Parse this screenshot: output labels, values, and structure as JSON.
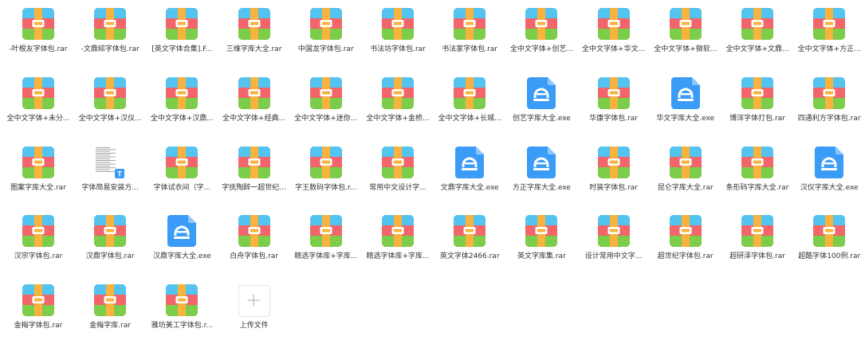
{
  "files": [
    {
      "name": "-叶根友字体包.rar",
      "icon": "archive-icon"
    },
    {
      "name": "-文鼎綜字体包.rar",
      "icon": "archive-icon"
    },
    {
      "name": "[英文字体合集].F...",
      "icon": "archive-icon"
    },
    {
      "name": "三维字库大全.rar",
      "icon": "archive-icon"
    },
    {
      "name": "中国龙字体包.rar",
      "icon": "archive-icon"
    },
    {
      "name": "书法坊字体包.rar",
      "icon": "archive-icon"
    },
    {
      "name": "书法家字体包.rar",
      "icon": "archive-icon"
    },
    {
      "name": "全中文字体+创艺...",
      "icon": "archive-icon"
    },
    {
      "name": "全中文字体+华文...",
      "icon": "archive-icon"
    },
    {
      "name": "全中文字体+微软...",
      "icon": "archive-icon"
    },
    {
      "name": "全中文字体+文鼎...",
      "icon": "archive-icon"
    },
    {
      "name": "全中文字体+方正...",
      "icon": "archive-icon"
    },
    {
      "name": "全中文字体+未分...",
      "icon": "archive-icon"
    },
    {
      "name": "全中文字体+汉仪...",
      "icon": "archive-icon"
    },
    {
      "name": "全中文字体+汉鼎...",
      "icon": "archive-icon"
    },
    {
      "name": "全中文字体+经典...",
      "icon": "archive-icon"
    },
    {
      "name": "全中文字体+迷你...",
      "icon": "archive-icon"
    },
    {
      "name": "全中文字体+金桥...",
      "icon": "archive-icon"
    },
    {
      "name": "全中文字体+长城...",
      "icon": "archive-icon"
    },
    {
      "name": "创艺字库大全.exe",
      "icon": "installer-icon"
    },
    {
      "name": "华康字体包.rar",
      "icon": "archive-icon"
    },
    {
      "name": "华文字库大全.exe",
      "icon": "installer-icon"
    },
    {
      "name": "博洋字体打包.rar",
      "icon": "archive-icon"
    },
    {
      "name": "四通利方字体包.rar",
      "icon": "archive-icon"
    },
    {
      "name": "图案字库大全.rar",
      "icon": "archive-icon"
    },
    {
      "name": "字体简易安装方...",
      "icon": "document-icon"
    },
    {
      "name": "字体试衣间（字...",
      "icon": "archive-icon"
    },
    {
      "name": "字抚陶醉一超世纪...",
      "icon": "archive-icon"
    },
    {
      "name": "字王数码字体包.r...",
      "icon": "archive-icon"
    },
    {
      "name": "常用中文设计字...",
      "icon": "archive-icon"
    },
    {
      "name": "文鼎字库大全.exe",
      "icon": "installer-icon"
    },
    {
      "name": "方正字库大全.exe",
      "icon": "installer-icon"
    },
    {
      "name": "时装字体包.rar",
      "icon": "archive-icon"
    },
    {
      "name": "昆仑字库大全.rar",
      "icon": "archive-icon"
    },
    {
      "name": "条形码字库大全.rar",
      "icon": "archive-icon"
    },
    {
      "name": "汉仪字库大全.exe",
      "icon": "installer-icon"
    },
    {
      "name": "汉宗字体包.rar",
      "icon": "archive-icon"
    },
    {
      "name": "汉鼎字体包.rar",
      "icon": "archive-icon"
    },
    {
      "name": "汉鼎字库大全.exe",
      "icon": "installer-icon"
    },
    {
      "name": "白舟字体包.rar",
      "icon": "archive-icon"
    },
    {
      "name": "精选字体库+字库...",
      "icon": "archive-icon"
    },
    {
      "name": "精选字体库+字库...",
      "icon": "archive-icon"
    },
    {
      "name": "英文字体2466.rar",
      "icon": "archive-icon"
    },
    {
      "name": "英文字库集.rar",
      "icon": "archive-icon"
    },
    {
      "name": "设计常用中文字...",
      "icon": "archive-icon"
    },
    {
      "name": "超世纪字体包.rar",
      "icon": "archive-icon"
    },
    {
      "name": "超研泽字体包.rar",
      "icon": "archive-icon"
    },
    {
      "name": "超酷字体100例.rar",
      "icon": "archive-icon"
    },
    {
      "name": "金梅字体包.rar",
      "icon": "archive-icon"
    },
    {
      "name": "金梅字库.rar",
      "icon": "archive-icon"
    },
    {
      "name": "雅坊美工字体包.r...",
      "icon": "archive-icon"
    }
  ],
  "upload": {
    "label": "上传文件",
    "icon": "plus-icon"
  },
  "colors": {
    "archive_top": "#53c3f0",
    "archive_mid": "#f2656a",
    "archive_bottom": "#7ccd4a",
    "archive_strap": "#f7b33e",
    "installer_blue": "#3a9cf6",
    "text": "#333333"
  }
}
